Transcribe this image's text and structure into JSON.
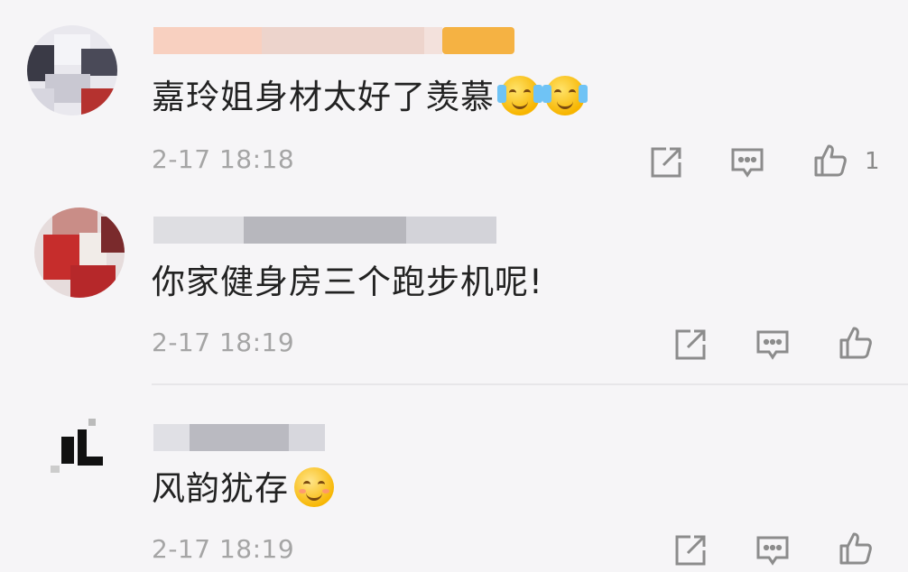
{
  "comments": [
    {
      "text": "嘉玲姐身材太好了羡慕",
      "emojis": [
        "crying-laughing",
        "crying-laughing"
      ],
      "timestamp": "2-17 18:18",
      "like_count": "1",
      "username_blurred": true,
      "username_badge_color": "#f5a623"
    },
    {
      "text": "你家健身房三个跑步机呢!",
      "emojis": [],
      "timestamp": "2-17 18:19",
      "like_count": "",
      "username_blurred": true
    },
    {
      "text": "风韵犹存",
      "emojis": [
        "smiling-face"
      ],
      "timestamp": "2-17 18:19",
      "like_count": "",
      "username_blurred": true
    }
  ],
  "icons": {
    "share": "share-icon",
    "reply": "comment-icon",
    "like": "thumbs-up-icon"
  },
  "colors": {
    "background": "#f6f5f7",
    "text": "#222222",
    "meta": "#a5a5a5",
    "icon": "#8c8c8c"
  }
}
